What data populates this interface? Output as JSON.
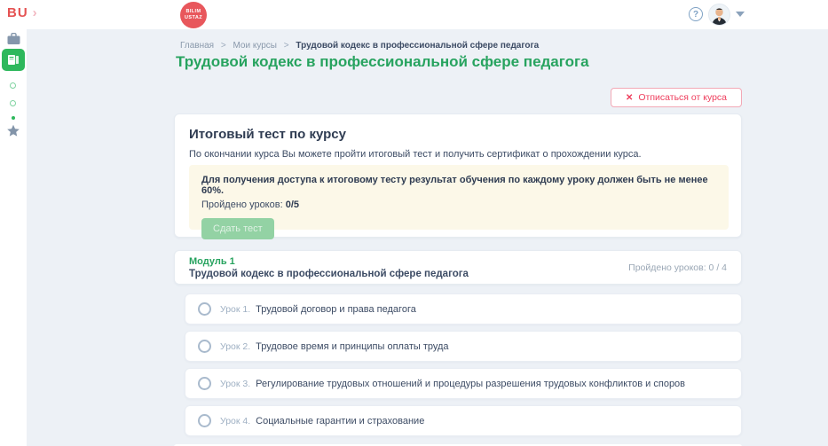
{
  "header": {
    "brand": "BU",
    "chevron": "›",
    "logo_line1": "BILIM",
    "logo_line2": "USTAZ",
    "help_symbol": "?"
  },
  "sidebar": {
    "icons": [
      "briefcase-icon",
      "book-courses-icon-active",
      "small-ring-icon",
      "small-ring-icon",
      "dot-icon",
      "star-icon"
    ]
  },
  "breadcrumb": {
    "separator": ">",
    "items": [
      "Главная",
      "Мои курсы",
      "Трудовой кодекс в профессиональной сфере педагога"
    ]
  },
  "page": {
    "title": "Трудовой кодекс в профессиональной сфере педагога",
    "unsubscribe_icon": "✕",
    "unsubscribe_label": "Отписаться от курса"
  },
  "final_test": {
    "title": "Итоговый тест по курсу",
    "description": "По окончании курса Вы можете пройти итоговый тест и получить сертификат о прохождении курса.",
    "notice_bold": "Для получения доступа к итоговому тесту результат обучения по каждому уроку должен быть не менее 60%.",
    "progress_label": "Пройдено уроков:",
    "progress_value": "0/5",
    "submit_label": "Сдать тест"
  },
  "module": {
    "name": "Модуль 1",
    "title": "Трудовой кодекс в профессиональной сфере педагога",
    "progress": "Пройдено уроков: 0 / 4",
    "lessons": [
      {
        "label": "Урок 1.",
        "title": "Трудовой договор и права педагога"
      },
      {
        "label": "Урок 2.",
        "title": "Трудовое время и принципы оплаты труда"
      },
      {
        "label": "Урок 3.",
        "title": "Регулирование трудовых отношений и процедуры разрешения трудовых конфликтов и споров"
      },
      {
        "label": "Урок 4.",
        "title": "Социальные гарантии и страхование"
      }
    ]
  },
  "colors": {
    "accent_green": "#2eb85c",
    "title_green": "#27a35f",
    "brand_red": "#e55353",
    "logo_red": "#e8575c",
    "unsubscribe_red": "#ee3d5c",
    "notice_bg": "#fcf8e8",
    "disabled_button_green": "#93d2a4",
    "content_bg": "#edf1f6",
    "text_dark": "#3c4b64",
    "text_muted": "#9fb0c3"
  }
}
